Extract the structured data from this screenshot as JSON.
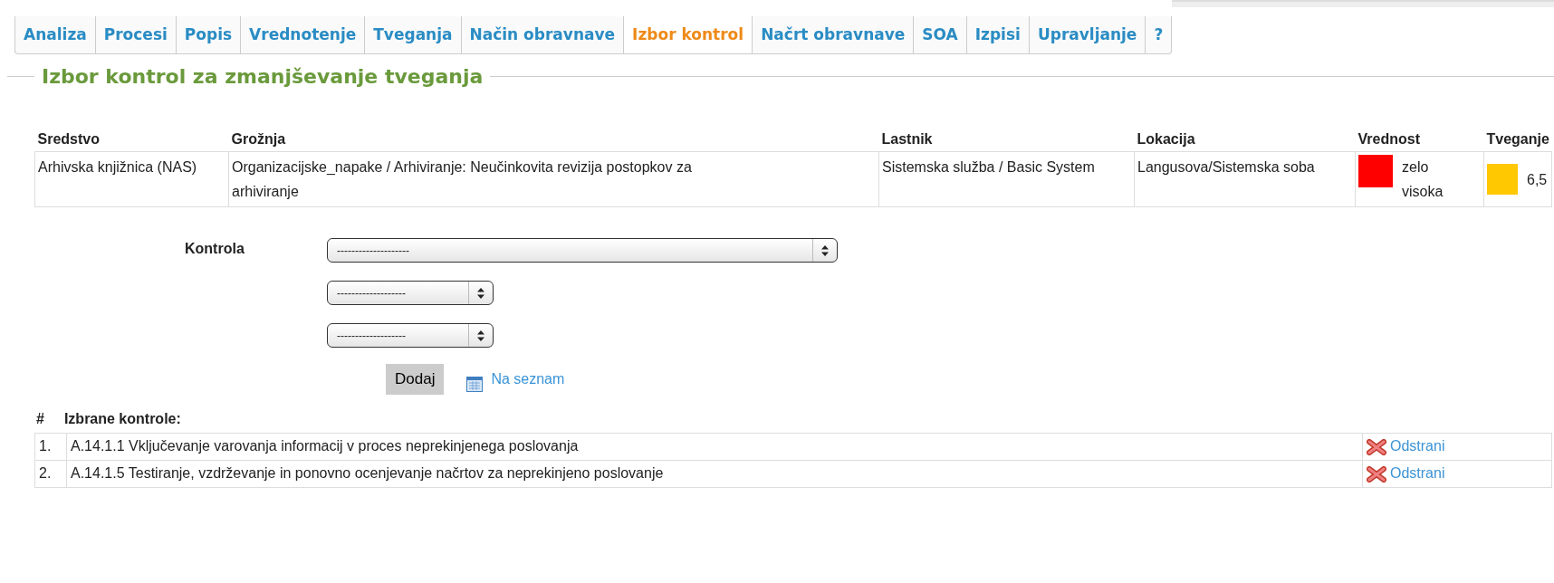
{
  "tabs": [
    {
      "label": "Analiza",
      "selected": false
    },
    {
      "label": "Procesi",
      "selected": false
    },
    {
      "label": "Popis",
      "selected": false
    },
    {
      "label": "Vrednotenje",
      "selected": false
    },
    {
      "label": "Tveganja",
      "selected": false
    },
    {
      "label": "Način obravnave",
      "selected": false
    },
    {
      "label": "Izbor kontrol",
      "selected": true
    },
    {
      "label": "Načrt obravnave",
      "selected": false
    },
    {
      "label": "SOA",
      "selected": false
    },
    {
      "label": "Izpisi",
      "selected": false
    },
    {
      "label": "Upravljanje",
      "selected": false
    },
    {
      "label": "?",
      "selected": false
    }
  ],
  "section_title": "Izbor kontrol za zmanjševanje tveganja",
  "table": {
    "columns": [
      "Sredstvo",
      "Grožnja",
      "Lastnik",
      "Lokacija",
      "Vrednost",
      "Tveganje"
    ],
    "rows": [
      {
        "sredstvo": "Arhivska knjižnica (NAS)",
        "groznja": "Organizacijske_napake / Arhiviranje: Neučinkovita revizija postopkov za arhiviranje",
        "lastnik": "Sistemska služba / Basic System",
        "lokacija": "Langusova/Sistemska soba",
        "vrednost": {
          "text": "zelo visoka",
          "color": "#ff0000"
        },
        "tveganje": {
          "text": "6,5",
          "color": "#ffc800"
        }
      }
    ]
  },
  "form": {
    "label": "Kontrola",
    "selects": [
      {
        "value": "--------------------",
        "wide": true
      },
      {
        "value": "-------------------",
        "wide": false
      },
      {
        "value": "-------------------",
        "wide": false
      }
    ],
    "add_button": "Dodaj",
    "list_link": "Na seznam"
  },
  "selected_controls": {
    "number_header": "#",
    "title": "Izbrane kontrole:",
    "items": [
      {
        "number": "1.",
        "text": "A.14.1.1 Vključevanje varovanja informacij v proces neprekinjenega poslovanja",
        "remove": "Odstrani"
      },
      {
        "number": "2.",
        "text": "A.14.1.5 Testiranje, vzdrževanje in ponovno ocenjevanje načrtov za neprekinjeno poslovanje",
        "remove": "Odstrani"
      }
    ]
  }
}
